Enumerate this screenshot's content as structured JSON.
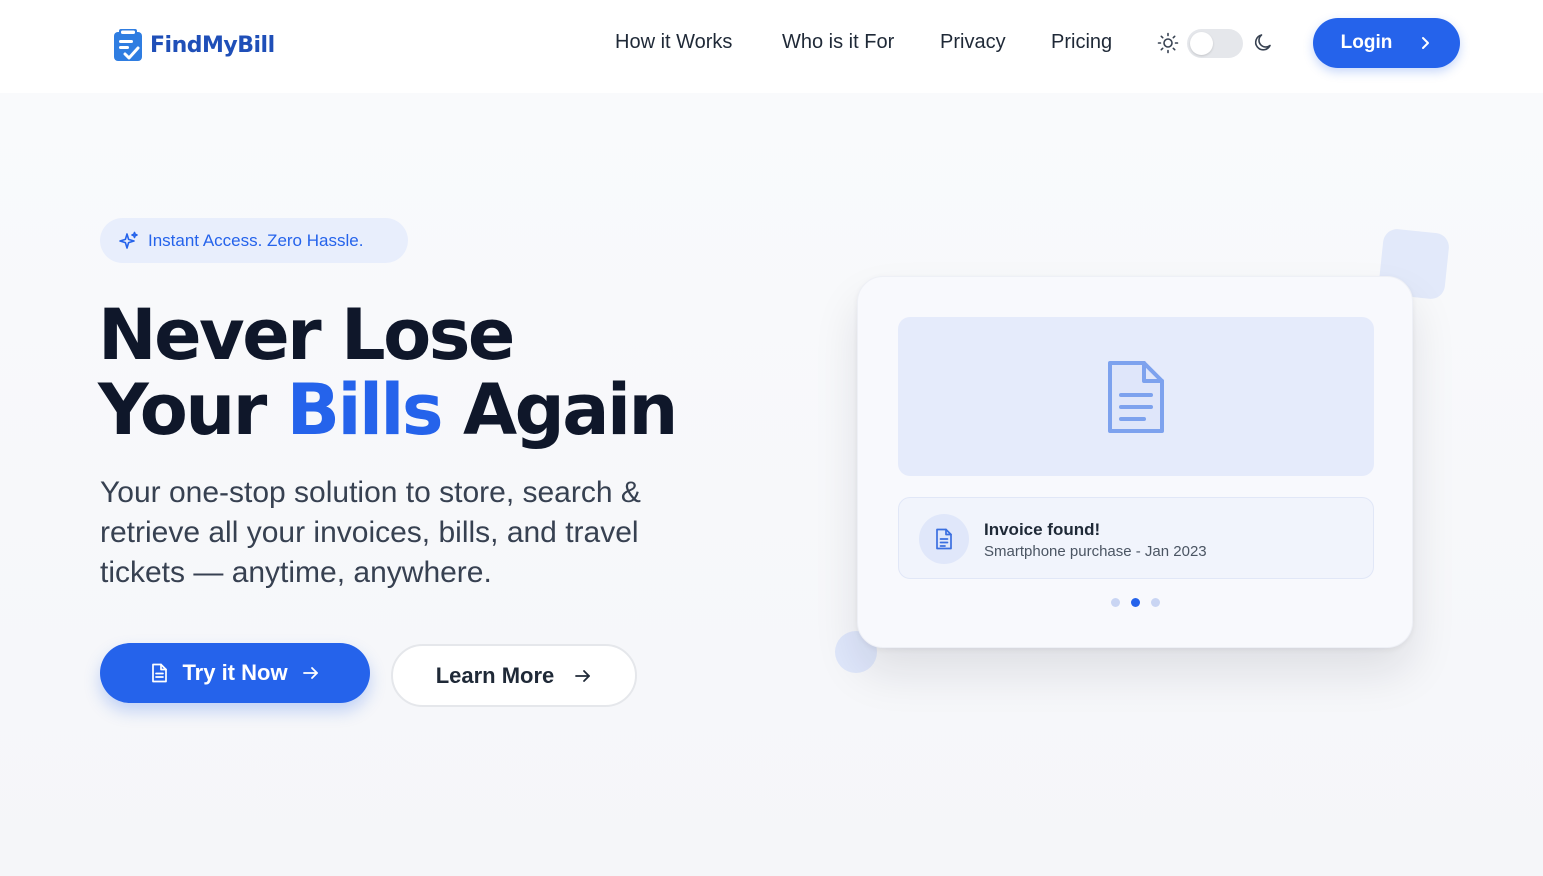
{
  "brand": {
    "name": "FindMyBill",
    "logo_icon": "clipboard-check-icon",
    "color": "#1f4fb8"
  },
  "nav": {
    "items": [
      {
        "label": "How it Works"
      },
      {
        "label": "Who is it For"
      },
      {
        "label": "Privacy"
      },
      {
        "label": "Pricing"
      }
    ],
    "theme_toggle": {
      "mode": "light",
      "light_icon": "sun-icon",
      "dark_icon": "moon-icon"
    },
    "login_label": "Login"
  },
  "hero": {
    "badge": {
      "icon": "sparkles-icon",
      "label": "Instant Access. Zero Hassle."
    },
    "headline": {
      "line1": "Never Lose",
      "line2_start": "Your",
      "line2_accent": "Bills",
      "line2_end": "Again"
    },
    "subtitle": "Your one-stop solution to store, search & retrieve all your invoices, bills, and travel tickets — anytime, anywhere.",
    "primary_cta": {
      "label": "Try it Now",
      "icon": "document-icon"
    },
    "secondary_cta": {
      "label": "Learn More",
      "icon": "arrow-right-icon"
    }
  },
  "illustration": {
    "preview_icon": "document-icon",
    "notification": {
      "title": "Invoice found!",
      "subtitle": "Smartphone purchase - Jan 2023"
    },
    "carousel": {
      "count": 3,
      "active_index": 1
    }
  },
  "colors": {
    "accent": "#2563eb",
    "heading": "#0f172a",
    "body": "#374151"
  }
}
